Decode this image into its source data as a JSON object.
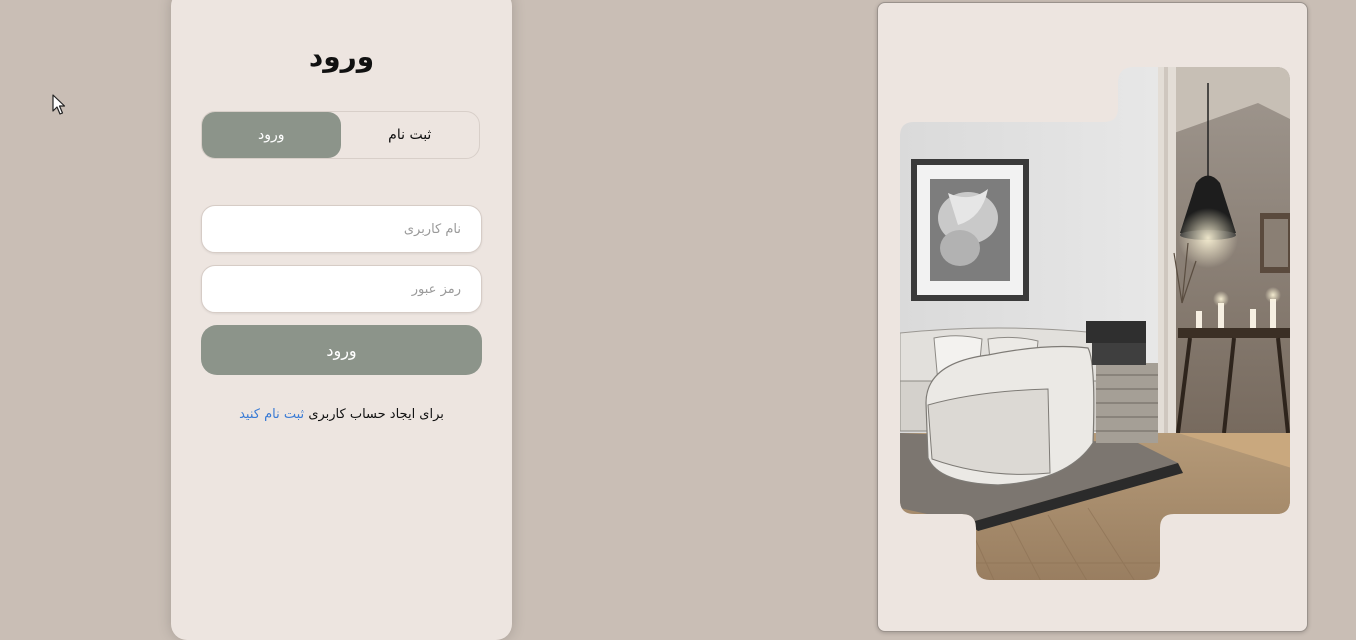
{
  "login_card": {
    "title": "ورود",
    "tabs": {
      "signup_label": "ثبت نام",
      "login_label": "ورود"
    },
    "username": {
      "placeholder": "نام کاربری",
      "value": ""
    },
    "password": {
      "placeholder": "رمز عبور",
      "value": ""
    },
    "submit_label": "ورود",
    "footer": {
      "text": "برای ایجاد حساب کاربری",
      "link_label": "ثبت نام کنید"
    }
  },
  "colors": {
    "page_background": "#c9beb5",
    "card_background": "#ede5e0",
    "accent": "#8c948a",
    "link": "#3a7bd5"
  },
  "icons": {
    "cursor": "mouse-pointer-icon"
  }
}
